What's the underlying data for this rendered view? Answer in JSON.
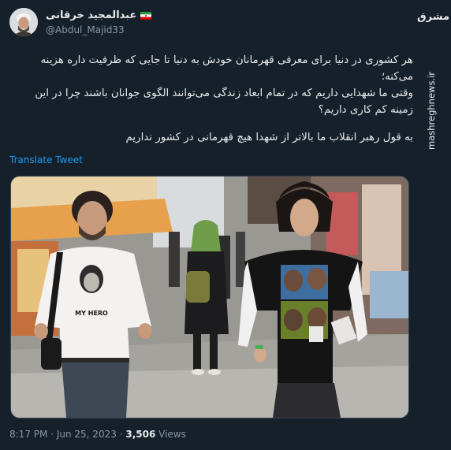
{
  "tweet": {
    "display_name": "عبدالمجید خرقانی",
    "flag_icon": "iran-flag-icon",
    "handle": "@Abdul_Majid33",
    "paragraphs": [
      "هر کشوری در دنیا برای معرفی قهرمانان خودش به دنیا تا جایی که ظرفیت داره هزینه می‌کنه؛",
      "وقتی ما شهدایی داریم که در تمام ابعاد زندگی می‌توانند الگوی جوانان باشند چرا در این زمینه کم کاری داریم؟",
      "به قول رهبر انقلاب ما بالاتر از شهدا هیچ قهرمانی در کشور نداریم"
    ],
    "translate_label": "Translate Tweet",
    "photo": {
      "shirt_text": "MY HERO"
    },
    "time": "8:17 PM",
    "separator": "·",
    "date": "Jun 25, 2023",
    "views_count": "3,506",
    "views_label": "Views"
  },
  "watermark": {
    "logo_text": "مشرق",
    "site_text": "mashreghnews.ir"
  },
  "colors": {
    "background": "#15202b",
    "text": "#e7e9ea",
    "secondary": "#8b98a5",
    "link": "#1d9bf0"
  }
}
